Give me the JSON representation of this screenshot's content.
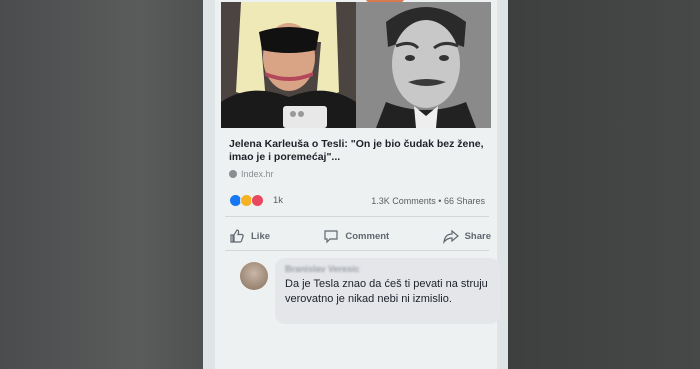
{
  "post": {
    "title": "Jelena Karleuša o Tesli: \"On je bio čudak bez žene, imao je i poremećaj\"...",
    "source": "Index.hr",
    "reaction_count": "1k",
    "stats": "1.3K Comments • 66 Shares",
    "reaction_colors": {
      "like": "#1877f2",
      "haha": "#f7b125",
      "love": "#e9495e"
    }
  },
  "actions": {
    "like": "Like",
    "comment": "Comment",
    "share": "Share"
  },
  "comment": {
    "author": "Branislav Veresic",
    "text": "Da je Tesla znao da ćeš ti pevati na struju verovatno je nikad nebi ni izmislio."
  }
}
